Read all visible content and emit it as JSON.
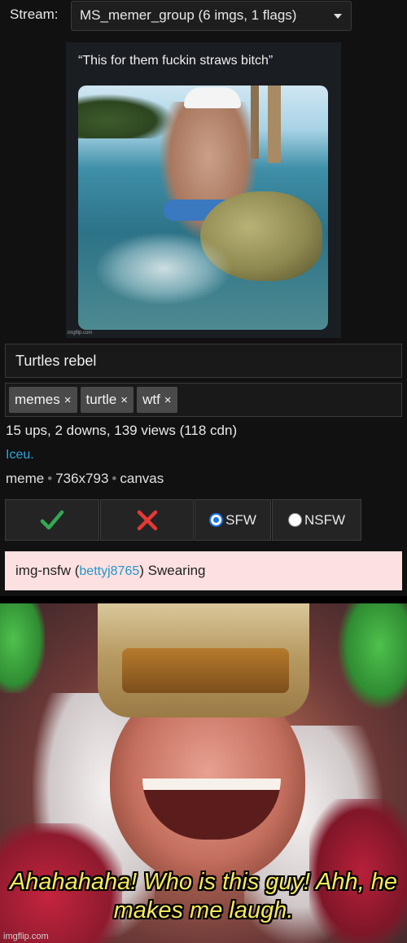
{
  "stream": {
    "label": "Stream:",
    "selected": "MS_memer_group (6 imgs, 1 flags)"
  },
  "post": {
    "image_caption": "“This for them fuckin straws bitch”",
    "image_watermark": "imgflip.com",
    "title": "Turtles rebel",
    "tags": [
      {
        "label": "memes",
        "remove": "×"
      },
      {
        "label": "turtle",
        "remove": "×"
      },
      {
        "label": "wtf",
        "remove": "×"
      }
    ],
    "stats": "15 ups, 2 downs, 139 views (118 cdn)",
    "user": "Iceu.",
    "meta": {
      "type": "meme",
      "dimensions": "736x793",
      "source": "canvas"
    }
  },
  "actions": {
    "approve_icon": "check-icon",
    "reject_icon": "cross-icon",
    "sfw_label": "SFW",
    "nsfw_label": "NSFW",
    "selected": "SFW",
    "approve_color": "#34a853",
    "reject_color": "#e53935"
  },
  "flag": {
    "prefix": "img-nsfw (",
    "user": "bettyj8765",
    "suffix": ") Swearing"
  },
  "reply_meme": {
    "caption": "Ahahahaha! Who is this guy! Ahh, he makes me laugh.",
    "watermark": "imgflip.com"
  }
}
